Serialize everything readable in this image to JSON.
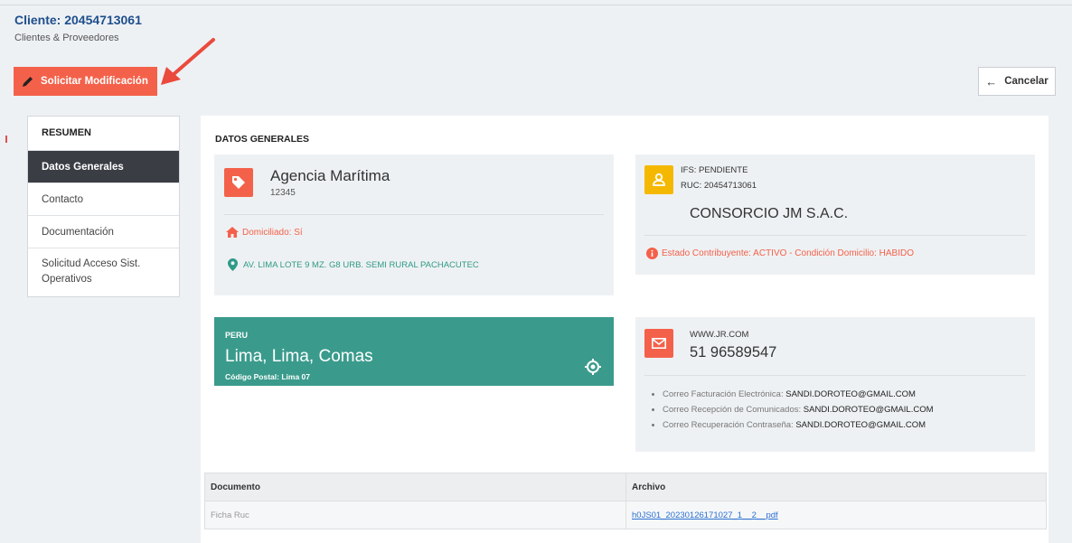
{
  "header": {
    "title": "Cliente: 20454713061",
    "subtitle": "Clientes & Proveedores"
  },
  "toolbar": {
    "request_label": "Solicitar Modificación",
    "cancel_label": "Cancelar"
  },
  "sidebar": {
    "heading": "RESUMEN",
    "items": [
      {
        "label": "Datos Generales",
        "active": true
      },
      {
        "label": "Contacto",
        "active": false
      },
      {
        "label": "Documentación",
        "active": false
      },
      {
        "label": "Solicitud Acceso Sist. Operativos",
        "active": false
      }
    ]
  },
  "content": {
    "section_title": "DATOS GENERALES",
    "agency_card": {
      "icon": "tag-icon",
      "name": "Agencia Marítima",
      "code": "12345",
      "domiciliado": "Domiciliado: Sí",
      "address": "AV. LIMA LOTE 9 MZ. G8 URB. SEMI RURAL PACHACUTEC"
    },
    "ruc_card": {
      "icon": "user-icon",
      "ifs": "IFS: PENDIENTE",
      "ruc": "RUC: 20454713061",
      "razon_social": "CONSORCIO JM S.A.C.",
      "estado": "Estado Contribuyente: ACTIVO - Condición Domicilio: HABIDO"
    },
    "location_card": {
      "country": "PERU",
      "city": "Lima, Lima, Comas",
      "postal": "Código Postal: Lima 07"
    },
    "contact_card": {
      "icon": "mail-icon",
      "website": "WWW.JR.COM",
      "phone": "51 96589547",
      "emails": [
        {
          "label": "Correo Facturación Electrónica:",
          "value": "SANDI.DOROTEO@GMAIL.COM"
        },
        {
          "label": "Correo Recepción de Comunicados:",
          "value": "SANDI.DOROTEO@GMAIL.COM"
        },
        {
          "label": "Correo Recuperación Contraseña:",
          "value": "SANDI.DOROTEO@GMAIL.COM"
        }
      ]
    },
    "documents": {
      "columns": [
        "Documento",
        "Archivo"
      ],
      "rows": [
        {
          "documento": "Ficha Ruc",
          "archivo": "h0JS01_20230126171027_1__2__pdf"
        }
      ]
    }
  },
  "colors": {
    "accent": "#f4614a",
    "teal": "#3a9b8c",
    "yellow": "#f5b800",
    "title_blue": "#1e4f8c"
  }
}
